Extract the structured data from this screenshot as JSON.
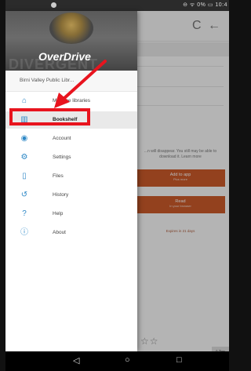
{
  "status_bar": {
    "right_text": "⊖ ᯤ 0% ▭ 10:4"
  },
  "app_toolbar": {
    "refresh_icon": "C",
    "back_icon": "←",
    "more_icon": "⋮"
  },
  "background": {
    "notice_text": "...n will disappear. You still may be able to download it. Learn more",
    "add_to_app": {
      "label": "Add to app",
      "sublabel": "Plus more"
    },
    "read": {
      "label": "Read",
      "sublabel": "In your browser"
    },
    "return_link": "Expires in 21 days",
    "stars": "☆☆",
    "top_button": "^ Top"
  },
  "drawer": {
    "brand": "OverDrive",
    "header_watermark": "DIVERGENT",
    "library_name": "Birni Valley Public Libr...",
    "items": [
      {
        "label": "Manage libraries",
        "icon": "home-icon",
        "glyph": "⌂"
      },
      {
        "label": "Bookshelf",
        "icon": "books-icon",
        "glyph": "▥"
      },
      {
        "label": "Account",
        "icon": "account-icon",
        "glyph": "◉"
      },
      {
        "label": "Settings",
        "icon": "gear-icon",
        "glyph": "⚙"
      },
      {
        "label": "Files",
        "icon": "file-icon",
        "glyph": "▯"
      },
      {
        "label": "History",
        "icon": "history-icon",
        "glyph": "↺"
      },
      {
        "label": "Help",
        "icon": "help-icon",
        "glyph": "?"
      },
      {
        "label": "About",
        "icon": "info-icon",
        "glyph": "ⓘ"
      }
    ]
  },
  "nav_bar": {
    "back": "◁",
    "home": "○",
    "recents": "□"
  },
  "colors": {
    "accent": "#2c87c6",
    "highlight": "#e8141e",
    "orange": "#cc5a2a"
  }
}
